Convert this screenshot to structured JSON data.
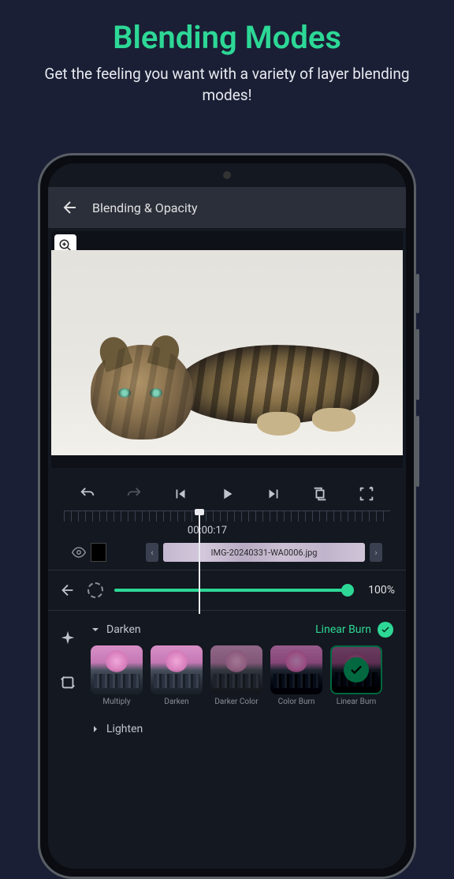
{
  "promo": {
    "title": "Blending Modes",
    "subtitle": "Get the feeling you want with a variety of layer blending modes!"
  },
  "topbar": {
    "title": "Blending & Opacity"
  },
  "timeline": {
    "timecode": "00:00:17",
    "clip_name": "IMG-20240331-WA0006.jpg"
  },
  "opacity": {
    "value": "100%"
  },
  "blend": {
    "category": "Darken",
    "selected": "Linear Burn",
    "options": [
      {
        "label": "Multiply"
      },
      {
        "label": "Darken"
      },
      {
        "label": "Darker Color"
      },
      {
        "label": "Color Burn"
      },
      {
        "label": "Linear Burn"
      }
    ],
    "next_category": "Lighten"
  }
}
